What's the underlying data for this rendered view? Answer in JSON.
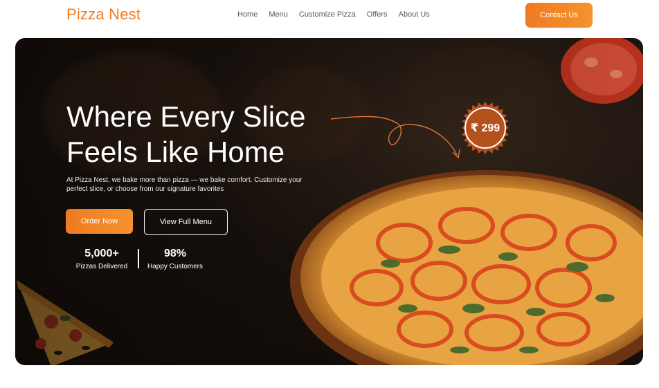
{
  "header": {
    "brand": "Pizza Nest",
    "nav": [
      "Home",
      "Menu",
      "Customize Pizza",
      "Offers",
      "About Us"
    ],
    "contact_label": "Contact Us"
  },
  "hero": {
    "title_line1": "Where Every Slice",
    "title_line2": "Feels Like Home",
    "description": "At Pizza Nest, we bake more than pizza — we bake comfort. Customize your perfect slice, or choose from our signature favorites",
    "order_label": "Order Now",
    "menu_label": "View Full Menu",
    "price_badge": "₹ 299",
    "stats": [
      {
        "value": "5,000+",
        "label": "Pizzas Delivered"
      },
      {
        "value": "98%",
        "label": "Happy Customers"
      }
    ]
  },
  "colors": {
    "accent": "#f07a21",
    "badge": "#b4511c",
    "hero_bg": "#1c140f"
  },
  "icons": [
    "curved-arrow-icon",
    "price-badge-icon"
  ]
}
